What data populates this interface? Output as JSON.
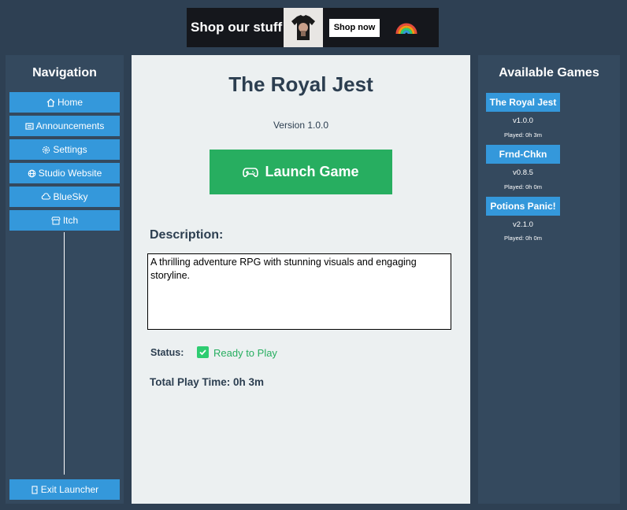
{
  "banner": {
    "text": "Shop our stuff",
    "button_label": "Shop now",
    "shirt_icon": "tshirt-icon",
    "rainbow_icon": "rainbow-icon"
  },
  "nav": {
    "title": "Navigation",
    "items": [
      {
        "label": "Home",
        "icon": "home-icon"
      },
      {
        "label": "Announcements",
        "icon": "newspaper-icon"
      },
      {
        "label": "Settings",
        "icon": "gear-icon"
      },
      {
        "label": "Studio Website",
        "icon": "globe-icon"
      },
      {
        "label": "BlueSky",
        "icon": "cloud-icon"
      },
      {
        "label": "Itch",
        "icon": "itch-icon"
      }
    ],
    "exit_label": "Exit Launcher"
  },
  "main": {
    "title": "The Royal Jest",
    "version": "Version 1.0.0",
    "launch_label": "Launch Game",
    "description_label": "Description:",
    "description": "A thrilling adventure RPG with stunning visuals and engaging storyline.",
    "status_label": "Status:",
    "status_value": "Ready to Play",
    "playtime": "Total Play Time: 0h 3m"
  },
  "games": {
    "title": "Available Games",
    "items": [
      {
        "name": "The Royal Jest",
        "version": "v1.0.0",
        "played": "Played: 0h 3m"
      },
      {
        "name": "Frnd-Chkn",
        "version": "v0.8.5",
        "played": "Played: 0h 0m"
      },
      {
        "name": "Potions Panic!",
        "version": "v2.1.0",
        "played": "Played: 0h 0m"
      }
    ]
  },
  "colors": {
    "background": "#2e4053",
    "panel": "#34495e",
    "accent": "#3498db",
    "launch": "#27ae60",
    "main_bg": "#ecf0f1"
  }
}
